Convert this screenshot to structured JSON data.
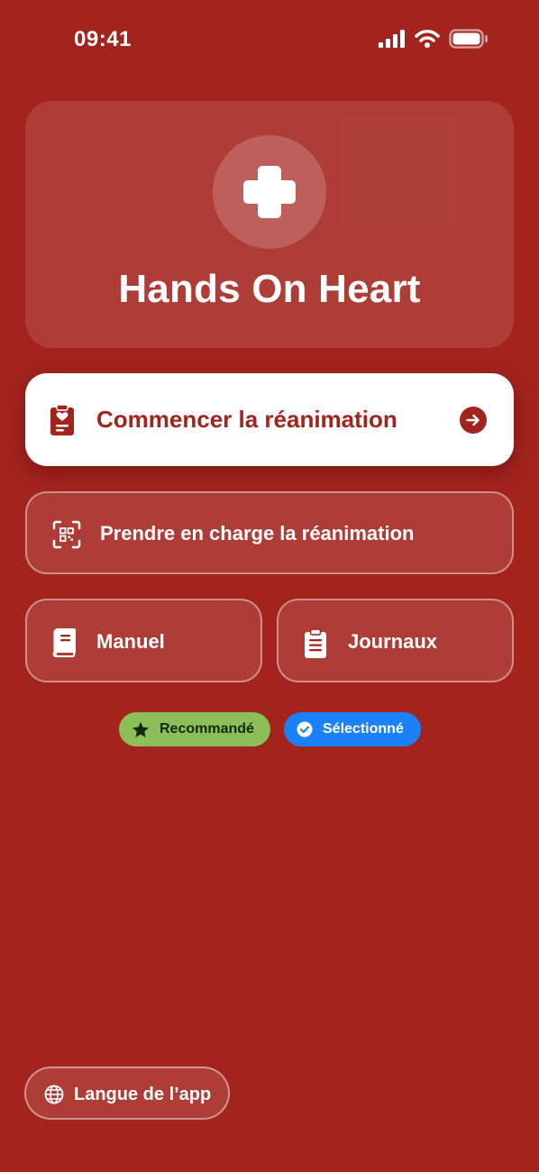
{
  "status_bar": {
    "time": "09:41"
  },
  "header": {
    "title": "Hands On Heart",
    "logo_icon": "medical-cross-icon"
  },
  "actions": {
    "start_label": "Commencer la réanimation",
    "takeover_label": "Prendre en charge la réanimation",
    "manual_label": "Manuel",
    "logs_label": "Journaux"
  },
  "badges": {
    "recommended_label": "Recommandé",
    "selected_label": "Sélectionné"
  },
  "language": {
    "label": "Langue de l’app"
  },
  "colors": {
    "background": "#a3231d",
    "primary_text": "#a3231d",
    "recommended_badge": "#8bc058",
    "selected_badge": "#1a82f6"
  },
  "icons": {
    "start": "clipboard-heart-icon",
    "takeover": "qr-scan-icon",
    "manual": "book-icon",
    "logs": "clipboard-list-icon",
    "language": "globe-icon"
  }
}
